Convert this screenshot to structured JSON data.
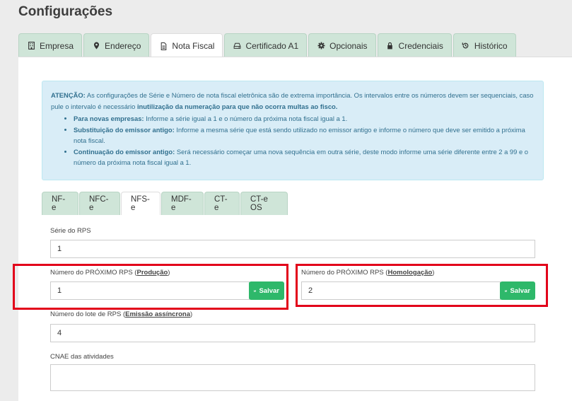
{
  "page": {
    "title": "Configurações"
  },
  "main_tabs": [
    {
      "label": "Empresa",
      "icon": "building-icon"
    },
    {
      "label": "Endereço",
      "icon": "map-marker-icon"
    },
    {
      "label": "Nota Fiscal",
      "icon": "document-icon",
      "active": true
    },
    {
      "label": "Certificado A1",
      "icon": "hdd-icon"
    },
    {
      "label": "Opcionais",
      "icon": "gear-icon"
    },
    {
      "label": "Credenciais",
      "icon": "lock-icon"
    },
    {
      "label": "Histórico",
      "icon": "history-icon"
    }
  ],
  "alert": {
    "lead_bold": "ATENÇÃO:",
    "lead_text": " As configurações de Série e Número de nota fiscal eletrônica são de extrema importância. Os intervalos entre os números devem ser sequenciais, caso pule o intervalo é necessário ",
    "lead_bold2": "inutilização da numeração para que não ocorra multas ao fisco.",
    "items": [
      {
        "bold": "Para novas empresas:",
        "text": " Informe a série igual a 1 e o número da próxima nota fiscal igual a 1."
      },
      {
        "bold": "Substituição do emissor antigo:",
        "text": " Informe a mesma série que está sendo utilizado no emissor antigo e informe o número que deve ser emitido a próxima nota fiscal."
      },
      {
        "bold": "Continuação do emissor antigo:",
        "text": " Será necessário começar uma nova sequência em outra série, deste modo informe uma série diferente entre 2 a 99 e o número da próxima nota fiscal igual a 1."
      }
    ]
  },
  "sub_tabs": [
    {
      "label": "NF-e"
    },
    {
      "label": "NFC-e"
    },
    {
      "label": "NFS-e",
      "active": true
    },
    {
      "label": "MDF-e"
    },
    {
      "label": "CT-e"
    },
    {
      "label": "CT-e OS"
    }
  ],
  "form": {
    "serie_label": "Série do RPS",
    "serie_value": "1",
    "prod_label_pre": "Número do PRÓXIMO RPS (",
    "prod_label_link": "Produção",
    "prod_label_post": ")",
    "prod_value": "1",
    "hom_label_pre": "Número do PRÓXIMO RPS (",
    "hom_label_link": "Homologação",
    "hom_label_post": ")",
    "hom_value": "2",
    "save_label": "Salvar",
    "lote_label_pre": "Número do lote de RPS (",
    "lote_label_link": "Emissão assíncrona",
    "lote_label_post": ")",
    "lote_value": "4",
    "cnae_label": "CNAE das atividades",
    "cnae_value": ""
  },
  "colors": {
    "highlight": "#e2001a",
    "save": "#2eb86a",
    "tab": "#cfe5d8",
    "alert_bg": "#d9edf7"
  }
}
